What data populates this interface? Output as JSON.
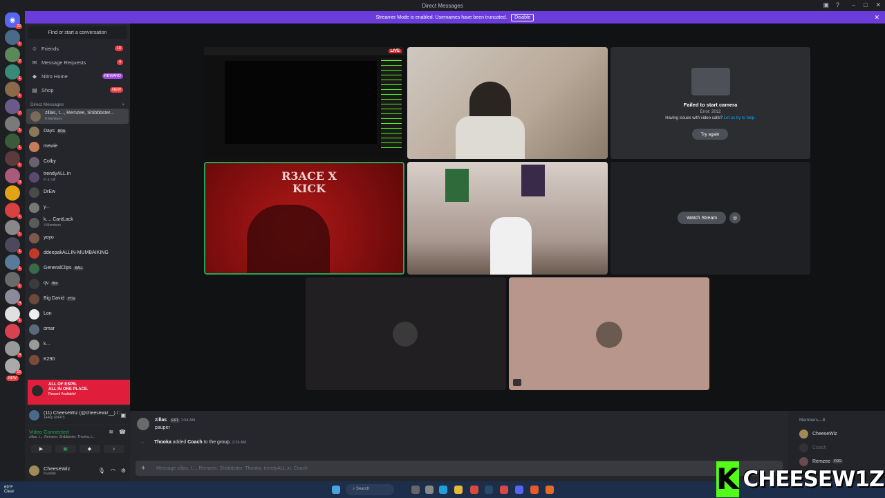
{
  "titlebar": {
    "title": "Direct Messages"
  },
  "banner": {
    "text": "Streamer Mode is enabled. Usernames have been truncated.",
    "button": "Disable"
  },
  "rail": {
    "home_badge": "22",
    "new_label": "NEW"
  },
  "sidebar": {
    "find": "Find or start a conversation",
    "nav": [
      {
        "label": "Friends",
        "badge": "18",
        "icon": "friends-icon"
      },
      {
        "label": "Message Requests",
        "badge": "4",
        "icon": "inbox-icon"
      },
      {
        "label": "Nitro Home",
        "badge": "REWARD",
        "icon": "nitro-icon"
      },
      {
        "label": "Shop",
        "badge": "NEW",
        "icon": "shop-icon"
      }
    ],
    "dm_header": "Direct Messages",
    "dms": [
      {
        "name": "zillas, t..., Remzee, Shibbbster...",
        "sub": "8 Members",
        "color": "#7a6a5a"
      },
      {
        "name": "Days",
        "tag": "BDA",
        "sub": "",
        "color": "#8a7a5a"
      },
      {
        "name": "mewie",
        "sub": "",
        "color": "#c87b5a"
      },
      {
        "name": "Colby",
        "sub": "",
        "color": "#6a6070"
      },
      {
        "name": "trendyALL.in",
        "sub": "In a call",
        "color": "#5a4a70"
      },
      {
        "name": "DrEw",
        "sub": "",
        "color": "#4a4a4a"
      },
      {
        "name": "y...",
        "sub": "",
        "color": "#777"
      },
      {
        "name": "k..., CantLack",
        "sub": "3 Members",
        "color": "#5a5a5a"
      },
      {
        "name": "yoyo",
        "sub": "",
        "color": "#7a5a4a"
      },
      {
        "name": "ddeepakALLIN-MUMBAIKING",
        "sub": "",
        "color": "#c0392b"
      },
      {
        "name": "GeneralClips",
        "tag": "BAU",
        "sub": "",
        "color": "#3a6a4a"
      },
      {
        "name": "qv",
        "tag": "flex",
        "sub": "",
        "color": "#3b3b3b"
      },
      {
        "name": "Big David",
        "tag": "YTG",
        "sub": "",
        "color": "#6a4a3a"
      },
      {
        "name": "Lon",
        "sub": "",
        "color": "#eeeeee"
      },
      {
        "name": "omar",
        "sub": "",
        "color": "#5a6a7a"
      },
      {
        "name": "k...",
        "sub": "",
        "color": "#9a9a9a"
      },
      {
        "name": "K290",
        "sub": "",
        "color": "#7a4a3a"
      }
    ],
    "promo": {
      "line1": "ALL OF ESPN.",
      "line2": "ALL IN ONE PLACE.",
      "reward": "Reward Available!"
    },
    "stream": {
      "title": "(11) CheeseWiz (@cheesewiz__) / X ...",
      "sub": "1440p 60FPS"
    },
    "voice": {
      "status": "Video Connected",
      "members": "zillas, t..., Remzee, Shibbbster, Thooka, t..."
    },
    "user": {
      "name": "CheeseWiz",
      "status": "Invisible"
    }
  },
  "tiles": {
    "live": "LIVE",
    "camera_error": {
      "title": "Failed to start camera",
      "code": "Error: 2012",
      "help": "Having issues with video calls?",
      "link": "Let us try to help.",
      "retry": "Try again"
    },
    "overlay_text": "R3ACE X KICK",
    "watch_stream": "Watch Stream"
  },
  "chat": {
    "messages": [
      {
        "author": "zillas",
        "tag": "EST",
        "time": "1:54 AM",
        "text": "pauper"
      },
      {
        "system": true,
        "author": "Thooka",
        "action": "added",
        "target": "Coach",
        "rest": "to the group.",
        "time": "2:26 AM"
      }
    ],
    "placeholder": "Message zillas, t..., Remzee, Shibbbster, Thooka, trendyALL.in, Coach"
  },
  "members": {
    "header": "Members—8",
    "list": [
      {
        "name": "CheeseWiz",
        "tag": ""
      },
      {
        "name": "Coach",
        "tag": ""
      },
      {
        "name": "Remzee",
        "tag": "FOO"
      }
    ]
  },
  "taskbar": {
    "temp": "69°F",
    "weather": "Clear",
    "search": "Search"
  },
  "brand": {
    "k": "K",
    "name": "CHEESEW1Z"
  },
  "colors": {
    "accent": "#6a3ddb",
    "kick": "#53fc18",
    "online": "#23a55a",
    "danger": "#f23f43"
  }
}
